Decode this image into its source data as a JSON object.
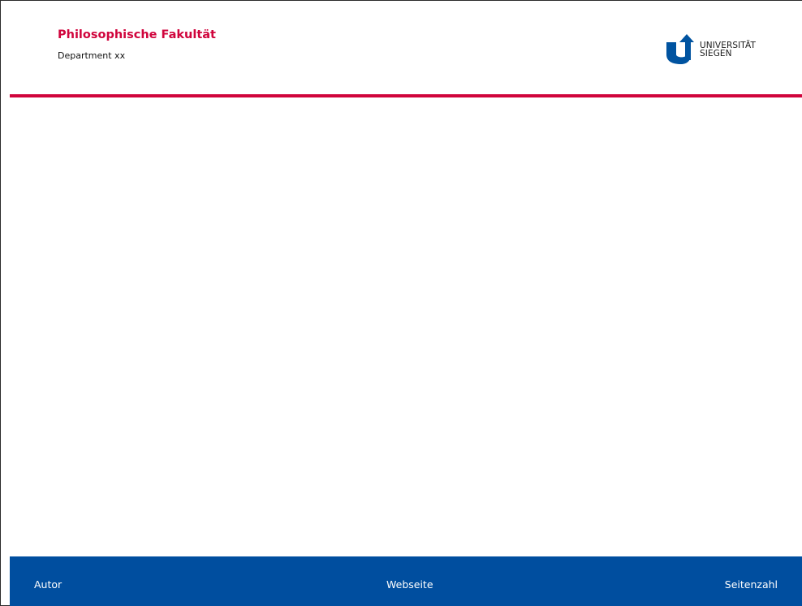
{
  "header": {
    "faculty_title": "Philosophische Fakultät",
    "department": "Department xx",
    "logo": {
      "icon": "university-siegen-logo-icon",
      "line1": "UNIVERSITÄT",
      "line2": "SIEGEN"
    }
  },
  "footer": {
    "author": "Autor",
    "website": "Webseite",
    "page_number": "Seitenzahl"
  },
  "colors": {
    "accent_red": "#d0043c",
    "footer_blue": "#004e9f",
    "logo_blue": "#0053a0",
    "text_dark": "#1a1a1a",
    "background": "#ffffff"
  }
}
